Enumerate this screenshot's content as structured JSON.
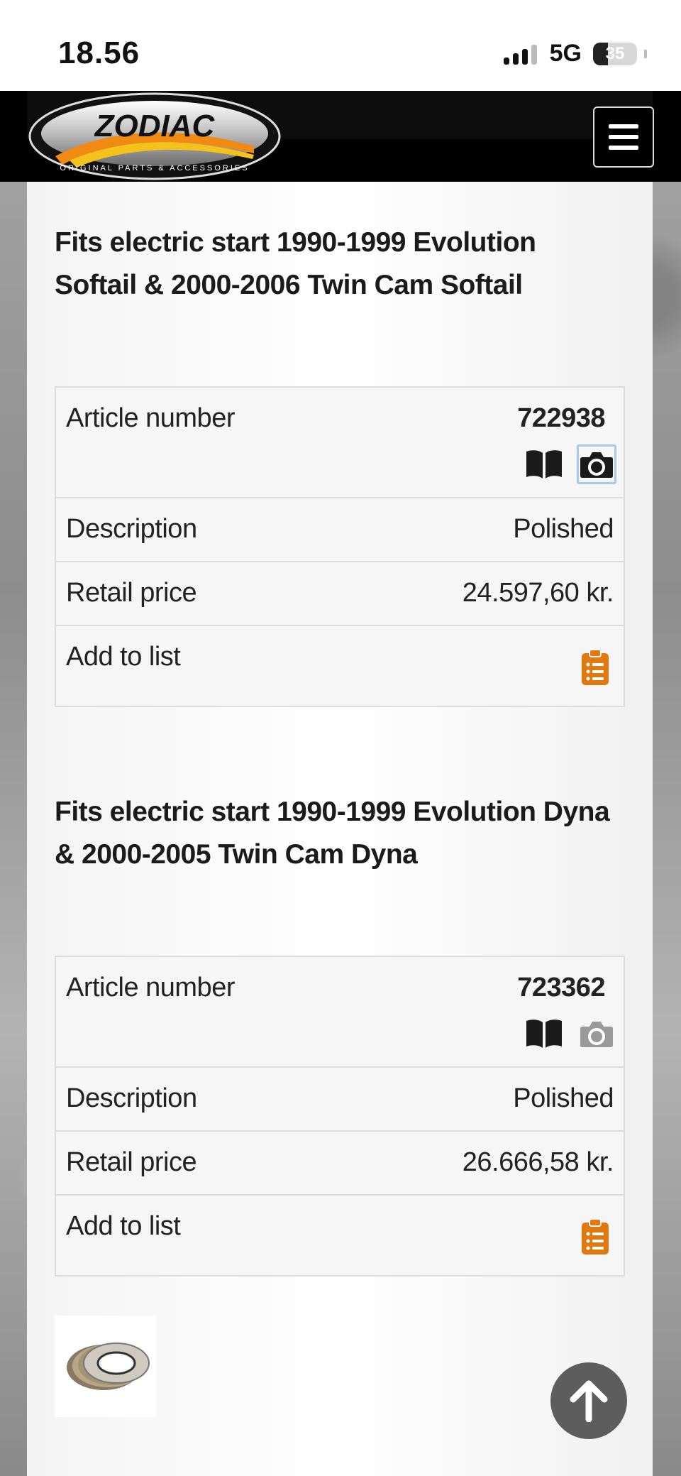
{
  "status_bar": {
    "time": "18.56",
    "network": "5G",
    "battery": "35"
  },
  "header": {
    "logo_text": "ZODIAC",
    "logo_tagline": "ORIGINAL PARTS & ACCESSORIES"
  },
  "products": [
    {
      "title": "Fits electric start 1990-1999 Evolution Softail & 2000-2006 Twin Cam Softail",
      "article_label": "Article number",
      "article_number": "722938",
      "description_label": "Description",
      "description": "Polished",
      "price_label": "Retail price",
      "price": "24.597,60 kr.",
      "add_label": "Add to list",
      "camera_active": true
    },
    {
      "title": "Fits electric start 1990-1999 Evolution Dyna & 2000-2005 Twin Cam Dyna",
      "article_label": "Article number",
      "article_number": "723362",
      "description_label": "Description",
      "description": "Polished",
      "price_label": "Retail price",
      "price": "26.666,58 kr.",
      "add_label": "Add to list",
      "camera_active": false
    }
  ],
  "icons": {
    "catalog": "book-icon",
    "photo": "camera-icon",
    "list": "clipboard-list-icon",
    "menu": "hamburger-icon",
    "scroll": "arrow-up-icon"
  },
  "colors": {
    "accent": "#e07a10",
    "navbar": "#000000",
    "scroll_button": "#5d5d5d"
  }
}
